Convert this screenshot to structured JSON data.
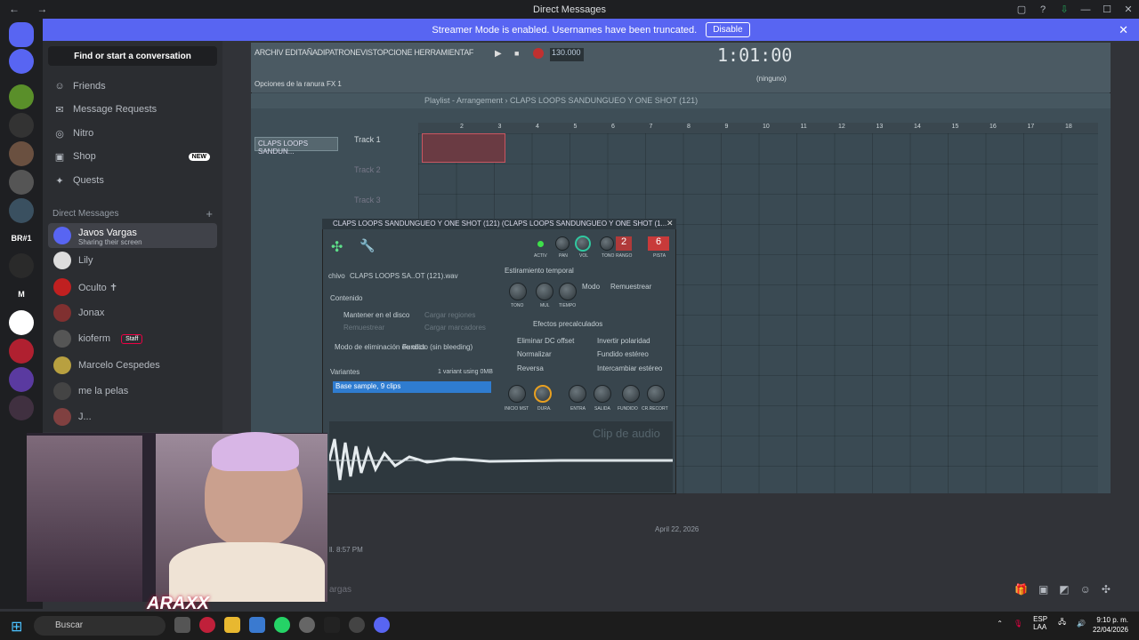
{
  "window": {
    "title": "Direct Messages",
    "nav": "← →"
  },
  "banner": {
    "text": "Streamer Mode is enabled. Usernames have been truncated.",
    "button": "Disable"
  },
  "sidebar": {
    "find": "Find or start a conversation",
    "items": [
      {
        "label": "Friends",
        "icon": "friends-icon"
      },
      {
        "label": "Message Requests",
        "icon": "mail-icon"
      },
      {
        "label": "Nitro",
        "icon": "nitro-icon"
      },
      {
        "label": "Shop",
        "icon": "shop-icon",
        "badge": "NEW"
      },
      {
        "label": "Quests",
        "icon": "quests-icon"
      }
    ],
    "dm_header": "Direct Messages",
    "dms": [
      {
        "name": "Javos Vargas",
        "status": "Sharing their screen"
      },
      {
        "name": "Lily"
      },
      {
        "name": "Oculto ✝"
      },
      {
        "name": "Jonax"
      },
      {
        "name": "kioferm",
        "badge": "Staff"
      },
      {
        "name": "Marcelo Cespedes"
      },
      {
        "name": "me la pelas"
      },
      {
        "name": "J..."
      }
    ]
  },
  "servers": {
    "labels": [
      "BR#1",
      "M"
    ],
    "counts": [
      "8",
      "12",
      "1",
      "1",
      "3",
      "1",
      "37",
      "1"
    ]
  },
  "daw": {
    "menu": "ARCHIV EDITAÑADIPATRONEVISTOPCIONE HERRAMIENTAF",
    "hint": "Opciones de la ranura FX 1",
    "bpm": "130.000",
    "time": "1:01:00",
    "pattern": "(ninguno)",
    "playlist_title": "Playlist - Arrangement › CLAPS LOOPS SANDUNGUEO Y ONE SHOT (121)",
    "channel": "CLAPS LOOPS SANDUN...",
    "tracks": [
      "Track 1",
      "Track 2",
      "Track 3"
    ],
    "ruler": [
      "2",
      "3",
      "4",
      "5",
      "6",
      "7",
      "8",
      "9",
      "10",
      "11",
      "12",
      "13",
      "14",
      "15",
      "16",
      "17",
      "18"
    ],
    "sampler": {
      "title": "CLAPS LOOPS SANDUNGUEO Y ONE SHOT (121) (CLAPS LOOPS SANDUNGUEO Y ONE SHOT (1...",
      "file_label": "chivo",
      "file": "CLAPS LOOPS SA..OT (121).wav",
      "contenido": "Contenido",
      "keep": "Mantener en el disco",
      "load_regions": "Cargar regiones",
      "resample": "Remuestrear",
      "load_markers": "Cargar marcadores",
      "delete_mode_label": "Modo de eliminación de clics",
      "delete_mode": "Fundido (sin bleeding)",
      "variants": "Variantes",
      "variants_info": "1 variant using 0MB",
      "variant_item": "Base sample, 9 clips",
      "stretch": "Estiramiento temporal",
      "mode_label": "Modo",
      "mode": "Remuestrear",
      "knob_labels": [
        "TONO",
        "MUL",
        "TIEMPO"
      ],
      "effects": "Efectos precalculados",
      "opts": [
        "Eliminar DC offset",
        "Invertir polaridad",
        "Normalizar",
        "Fundido estéreo",
        "Reversa",
        "Intercambiar estéreo"
      ],
      "bottom_knobs": [
        "INICIO MST",
        "DURA.",
        "ENTRA",
        "SALIDA",
        "FUNDIDO",
        "CR.RECORT"
      ],
      "top_knobs": [
        "ACTIV",
        "PAN",
        "VOL",
        "TONO",
        "RANGO",
        "PISTA"
      ],
      "range": "2",
      "track_num": "6",
      "clip_label": "Clip de audio"
    }
  },
  "chat": {
    "date": "April 22, 2026",
    "msg_time": "ll. 8:57 PM",
    "input": "argas"
  },
  "stream": {
    "logo": "ARAXX"
  },
  "taskbar": {
    "search": "Buscar",
    "lang1": "ESP",
    "lang2": "LAA",
    "time": "9:10 p. m.",
    "date": "22/04/2026"
  }
}
